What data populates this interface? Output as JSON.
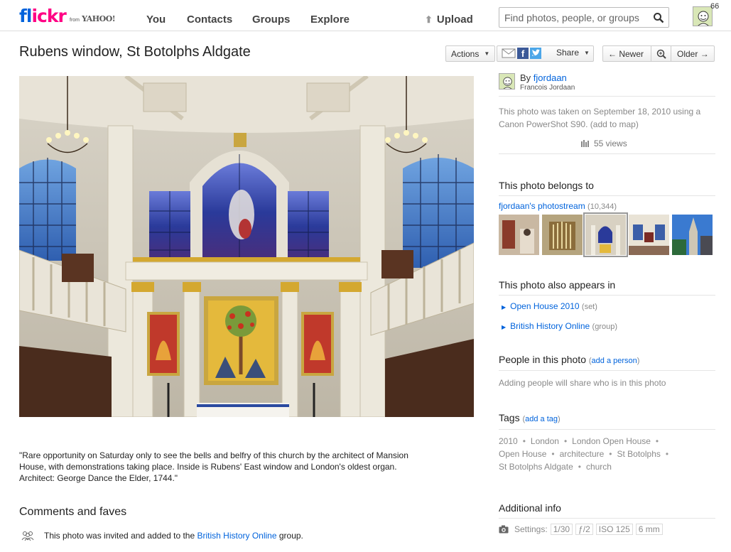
{
  "brand": {
    "fl": "fl",
    "ickr": "ickr",
    "from": "from",
    "yahoo": "YAHOO!"
  },
  "nav": {
    "you": "You",
    "contacts": "Contacts",
    "groups": "Groups",
    "explore": "Explore",
    "upload": "Upload"
  },
  "search": {
    "placeholder": "Find photos, people, or groups"
  },
  "user": {
    "notifications": "66"
  },
  "photo": {
    "title": "Rubens window, St Botolphs Aldgate",
    "description": "\"Rare opportunity on Saturday only to see the bells and belfry of this church by the architect of Mansion House, with demonstrations taking place. Inside is Rubens' East window and London's oldest organ. Architect: George Dance the Elder, 1744.\""
  },
  "actions": {
    "actions": "Actions",
    "share": "Share",
    "newer": "Newer",
    "older": "Older"
  },
  "owner": {
    "by": "By",
    "username": "fjordaan",
    "realname": "Francois Jordaan"
  },
  "taken": {
    "prefix": "This photo was taken on ",
    "date": "September 18, 2010",
    "middle": " using a",
    "camera": "Canon PowerShot S90",
    "suffix": ". (",
    "add_to_map": "add to map",
    "end": ")"
  },
  "views": "55 views",
  "belongs": {
    "heading": "This photo belongs to",
    "photostream": "fjordaan's photostream",
    "count": "(10,344)"
  },
  "appears": {
    "heading": "This photo also appears in",
    "items": [
      {
        "name": "Open House 2010",
        "type": "(set)"
      },
      {
        "name": "British History Online",
        "type": "(group)"
      }
    ]
  },
  "people": {
    "heading": "People in this photo",
    "add": "add a person",
    "note": "Adding people will share who is in this photo"
  },
  "tags": {
    "heading": "Tags",
    "add": "add a tag",
    "items": [
      "2010",
      "London",
      "London Open House",
      "Open House",
      "architecture",
      "St Botolphs",
      "St Botolphs Aldgate",
      "church"
    ]
  },
  "additional": {
    "heading": "Additional info",
    "settings_label": "Settings:",
    "shutter": "1/30",
    "aperture": "ƒ/2",
    "iso": "ISO 125",
    "focal": "6 mm"
  },
  "comments": {
    "heading": "Comments and faves",
    "invite_prefix": "This photo was invited and added to the ",
    "group": "British History Online",
    "invite_suffix": " group."
  },
  "colors": {
    "link": "#0063dc",
    "pink": "#ff0084",
    "muted": "#8a8a8a"
  },
  "icons": [
    "search-icon",
    "upload-arrow-icon",
    "email-icon",
    "facebook-icon",
    "twitter-icon",
    "zoom-icon",
    "views-icon",
    "camera-icon",
    "group-icon"
  ]
}
